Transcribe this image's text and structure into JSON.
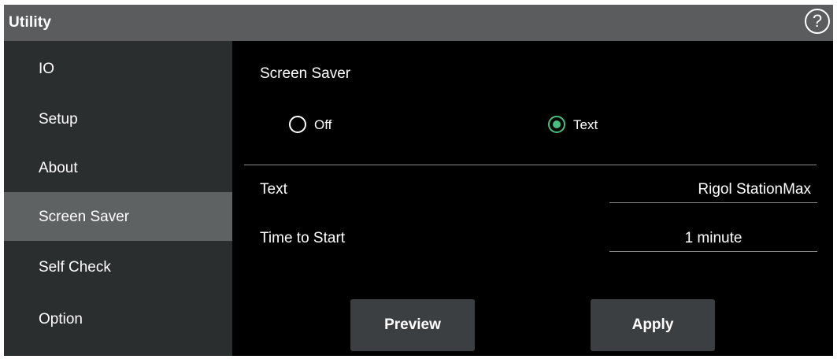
{
  "header": {
    "title": "Utility",
    "help_glyph": "?",
    "help_icon": "help-circle-icon"
  },
  "sidebar": {
    "items": [
      {
        "label": "IO"
      },
      {
        "label": "Setup"
      },
      {
        "label": "About"
      },
      {
        "label": "Screen Saver",
        "active": true
      },
      {
        "label": "Self Check"
      },
      {
        "label": "Option"
      }
    ]
  },
  "main": {
    "section_title": "Screen Saver",
    "mode_options": [
      {
        "label": "Off",
        "checked": false
      },
      {
        "label": "Text",
        "checked": true
      }
    ],
    "rows": [
      {
        "label": "Text",
        "value": "Rigol StationMax"
      },
      {
        "label": "Time to Start",
        "value": "1 minute"
      }
    ],
    "buttons": {
      "preview": "Preview",
      "apply": "Apply"
    }
  },
  "colors": {
    "titlebar": "#5a5c5e",
    "sidebar": "#2b2e2f",
    "sidebar_active": "#5f6263",
    "content_bg": "#000000",
    "radio_accent": "#45c07d",
    "button": "#3c3f41"
  }
}
